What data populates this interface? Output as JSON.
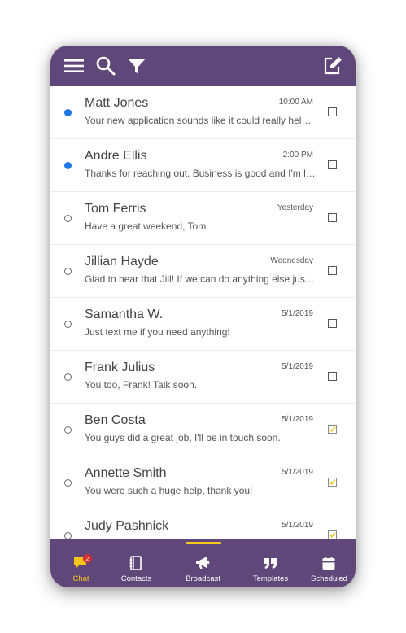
{
  "colors": {
    "brand": "#5f4879",
    "accent": "#f5c518",
    "unread": "#1f77e6",
    "badge": "#d32f2f"
  },
  "topbar": {
    "icons": [
      "hamburger-menu-icon",
      "search-icon",
      "filter-icon",
      "compose-icon"
    ]
  },
  "messages": [
    {
      "name": "Matt Jones",
      "time": "10:00 AM",
      "preview": "Your new application sounds like it could really help my business!",
      "unread": true,
      "checked": false
    },
    {
      "name": "Andre Ellis",
      "time": "2:00 PM",
      "preview": "Thanks for reaching out. Business is good and I'm looking to expand.",
      "unread": true,
      "checked": false
    },
    {
      "name": "Tom Ferris",
      "time": "Yesterday",
      "preview": "Have a great weekend, Tom.",
      "unread": false,
      "checked": false
    },
    {
      "name": "Jillian Hayde",
      "time": "Wednesday",
      "preview": "Glad to hear that Jill! If we can do anything else just let us know.",
      "unread": false,
      "checked": false
    },
    {
      "name": "Samantha W.",
      "time": "5/1/2019",
      "preview": "Just text me if you need anything!",
      "unread": false,
      "checked": false
    },
    {
      "name": "Frank Julius",
      "time": "5/1/2019",
      "preview": "You too, Frank! Talk soon.",
      "unread": false,
      "checked": false
    },
    {
      "name": "Ben Costa",
      "time": "5/1/2019",
      "preview": "You guys did a great job, I'll be in touch soon.",
      "unread": false,
      "checked": true
    },
    {
      "name": "Annette Smith",
      "time": "5/1/2019",
      "preview": "You were such a huge help, thank you!",
      "unread": false,
      "checked": true
    },
    {
      "name": "Judy Pashnick",
      "time": "5/1/2019",
      "preview": "",
      "unread": false,
      "checked": true
    }
  ],
  "bottom_nav": {
    "items": [
      {
        "label": "Chat",
        "icon": "chat-bubble-icon",
        "active": true,
        "badge": "2"
      },
      {
        "label": "Contacts",
        "icon": "contacts-book-icon",
        "active": false
      },
      {
        "label": "Broadcast",
        "icon": "megaphone-icon",
        "active": false
      },
      {
        "label": "Templates",
        "icon": "quote-icon",
        "active": false
      },
      {
        "label": "Scheduled",
        "icon": "calendar-icon",
        "active": false
      }
    ]
  }
}
